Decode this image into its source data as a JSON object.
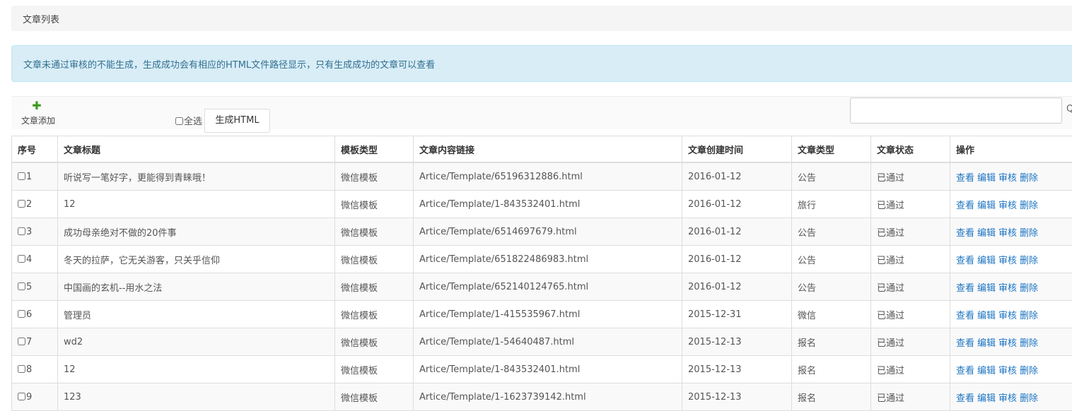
{
  "breadcrumb": "文章列表",
  "alert": "文章未通过审核的不能生成，生成成功会有相应的HTML文件路径显示，只有生成成功的文章可以查看",
  "toolbar": {
    "add_label": "文章添加",
    "select_all_label": "全选",
    "generate_label": "生成HTML",
    "search_icon_glyph": "Q"
  },
  "table": {
    "headers": [
      "序号",
      "文章标题",
      "模板类型",
      "文章内容链接",
      "文章创建时间",
      "文章类型",
      "文章状态",
      "操作"
    ],
    "actions": [
      "查看",
      "编辑",
      "审核",
      "删除"
    ],
    "rows": [
      {
        "id": "1",
        "title": "听说写一笔好字，更能得到青睐哦！",
        "template": "微信模板",
        "link": "Artice/Template/65196312886.html",
        "created": "2016-01-12",
        "type": "公告",
        "status": "已通过"
      },
      {
        "id": "2",
        "title": "12",
        "template": "微信模板",
        "link": "Artice/Template/1-843532401.html",
        "created": "2016-01-12",
        "type": "旅行",
        "status": "已通过"
      },
      {
        "id": "3",
        "title": "成功母亲绝对不做的20件事",
        "template": "微信模板",
        "link": "Artice/Template/6514697679.html",
        "created": "2016-01-12",
        "type": "公告",
        "status": "已通过"
      },
      {
        "id": "4",
        "title": "冬天的拉萨，它无关游客，只关乎信仰",
        "template": "微信模板",
        "link": "Artice/Template/651822486983.html",
        "created": "2016-01-12",
        "type": "公告",
        "status": "已通过"
      },
      {
        "id": "5",
        "title": "中国画的玄机--用水之法",
        "template": "微信模板",
        "link": "Artice/Template/652140124765.html",
        "created": "2016-01-12",
        "type": "公告",
        "status": "已通过"
      },
      {
        "id": "6",
        "title": "管理员",
        "template": "微信模板",
        "link": "Artice/Template/1-415535967.html",
        "created": "2015-12-31",
        "type": "微信",
        "status": "已通过"
      },
      {
        "id": "7",
        "title": "wd2",
        "template": "微信模板",
        "link": "Artice/Template/1-54640487.html",
        "created": "2015-12-13",
        "type": "报名",
        "status": "已通过"
      },
      {
        "id": "8",
        "title": "12",
        "template": "微信模板",
        "link": "Artice/Template/1-843532401.html",
        "created": "2015-12-13",
        "type": "报名",
        "status": "已通过"
      },
      {
        "id": "9",
        "title": "123",
        "template": "微信模板",
        "link": "Artice/Template/1-1623739142.html",
        "created": "2015-12-13",
        "type": "报名",
        "status": "已通过"
      }
    ]
  }
}
